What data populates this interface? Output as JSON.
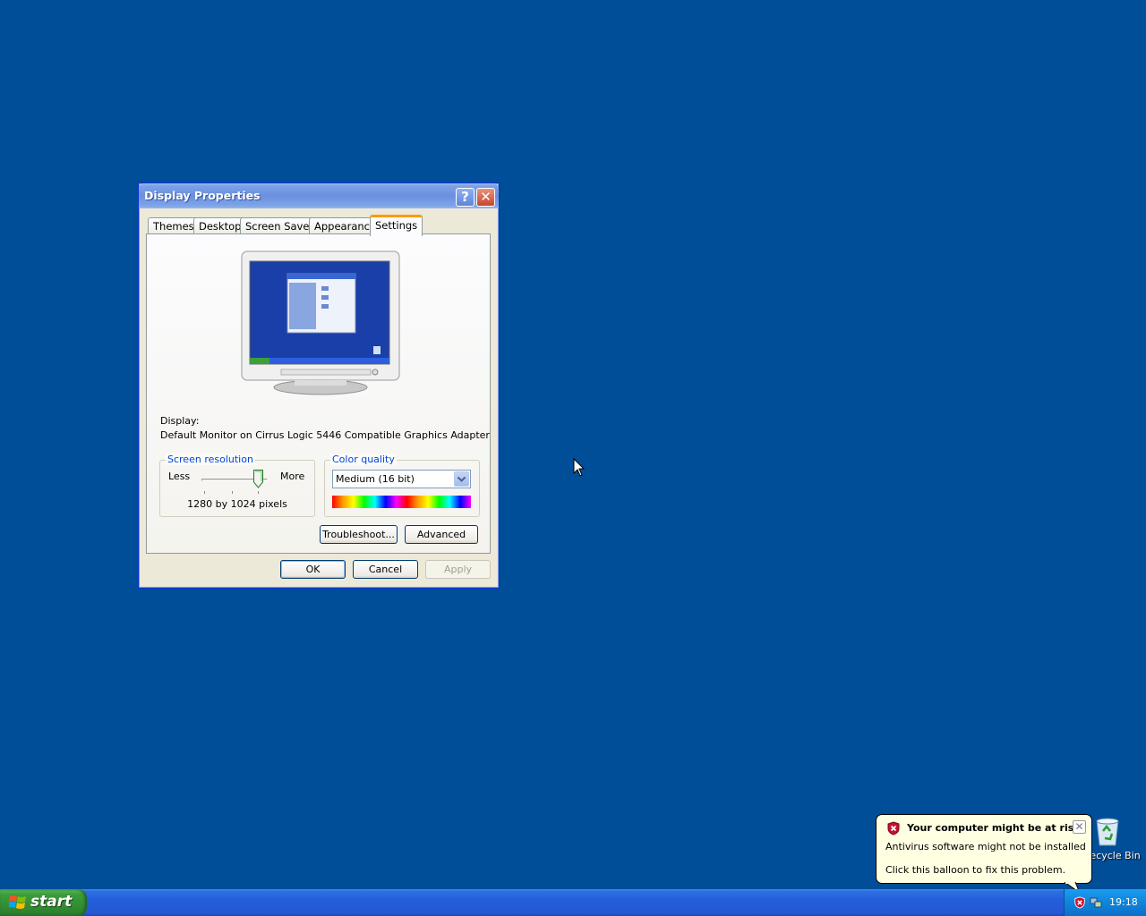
{
  "desktop": {
    "background_color": "#004e98",
    "recycle_bin_label": "Recycle Bin"
  },
  "dialog": {
    "title": "Display Properties",
    "help_button": "?",
    "close_button": "✕",
    "tabs": [
      {
        "label": "Themes",
        "active": false
      },
      {
        "label": "Desktop",
        "active": false
      },
      {
        "label": "Screen Saver",
        "active": false
      },
      {
        "label": "Appearance",
        "active": false
      },
      {
        "label": "Settings",
        "active": true
      }
    ],
    "display_label": "Display:",
    "display_value": "Default Monitor on Cirrus Logic 5446 Compatible Graphics Adapter",
    "screen_resolution": {
      "legend": "Screen resolution",
      "less_label": "Less",
      "more_label": "More",
      "value_text": "1280 by 1024 pixels"
    },
    "color_quality": {
      "legend": "Color quality",
      "selected": "Medium (16 bit)"
    },
    "buttons": {
      "troubleshoot": "Troubleshoot...",
      "advanced": "Advanced",
      "ok": "OK",
      "cancel": "Cancel",
      "apply": "Apply"
    }
  },
  "balloon": {
    "title": "Your computer might be at risk",
    "line1": "Antivirus software might not be installed",
    "line2": "Click this balloon to fix this problem.",
    "close": "✕"
  },
  "taskbar": {
    "start_label": "start",
    "clock": "19:18"
  },
  "icons": [
    "recycle-bin-icon",
    "shield-icon",
    "network-icon",
    "windows-logo-icon",
    "mouse-cursor-icon",
    "chevron-down-icon"
  ]
}
